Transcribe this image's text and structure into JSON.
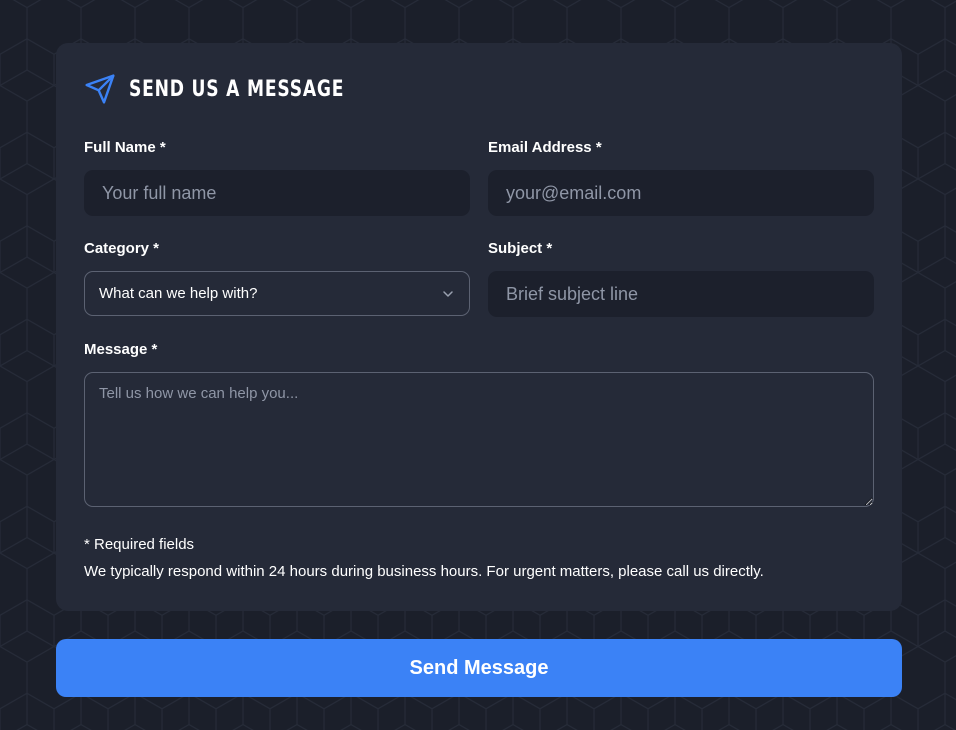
{
  "form": {
    "title": "SEND US A MESSAGE",
    "title_icon": "paper-plane-icon",
    "full_name": {
      "label": "Full Name *",
      "placeholder": "Your full name",
      "value": ""
    },
    "email": {
      "label": "Email Address *",
      "placeholder": "your@email.com",
      "value": ""
    },
    "category": {
      "label": "Category *",
      "selected": "What can we help with?",
      "icon": "chevron-down-icon"
    },
    "subject": {
      "label": "Subject *",
      "placeholder": "Brief subject line",
      "value": ""
    },
    "message": {
      "label": "Message *",
      "placeholder": "Tell us how we can help you...",
      "value": ""
    },
    "required_note": "* Required fields",
    "response_note": "We typically respond within 24 hours during business hours. For urgent matters, please call us directly.",
    "submit_label": "Send Message"
  },
  "colors": {
    "background": "#1b1f2a",
    "card": "#252a38",
    "input": "#1c202c",
    "accent": "#3b82f6",
    "text": "#ffffff",
    "placeholder": "#8f96a6"
  }
}
